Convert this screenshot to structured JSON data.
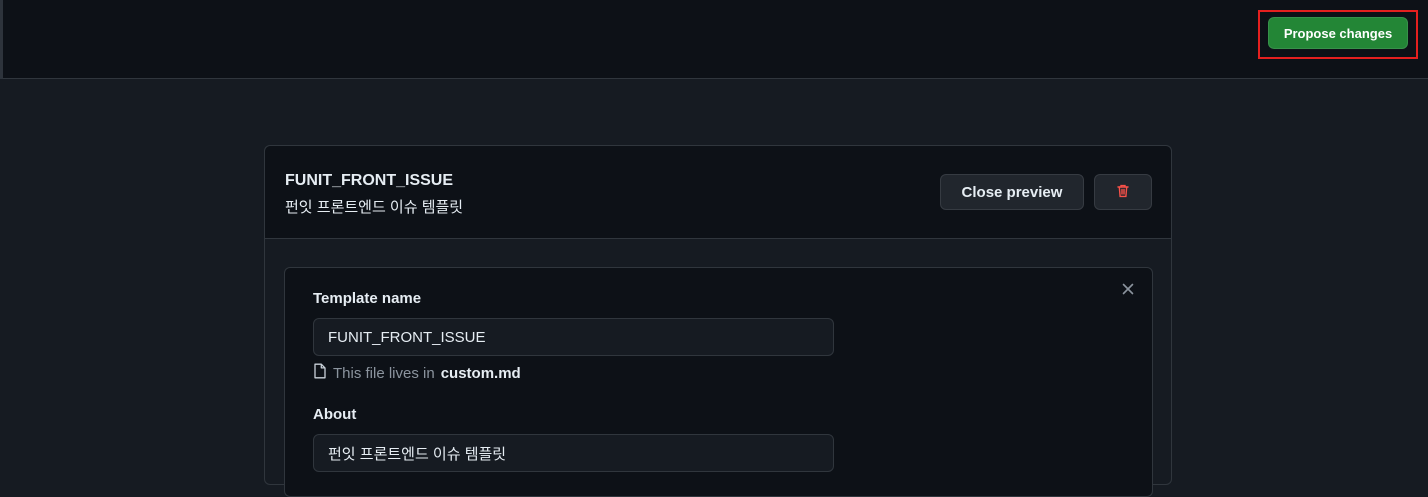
{
  "header": {
    "propose_label": "Propose changes"
  },
  "template_card": {
    "title": "FUNIT_FRONT_ISSUE",
    "subtitle": "펀잇 프론트엔드 이슈 템플릿",
    "close_preview_label": "Close preview",
    "delete_icon": "trash-icon"
  },
  "form": {
    "close_icon": "close-icon",
    "template_name_label": "Template name",
    "template_name_value": "FUNIT_FRONT_ISSUE",
    "file_note_prefix": "This file lives in",
    "file_name": "custom.md",
    "file_icon": "file-icon",
    "about_label": "About",
    "about_value": "펀잇 프론트엔드 이슈 템플릿"
  },
  "colors": {
    "primary_button": "#238636",
    "danger": "#f85149",
    "highlight": "#e5201f"
  }
}
